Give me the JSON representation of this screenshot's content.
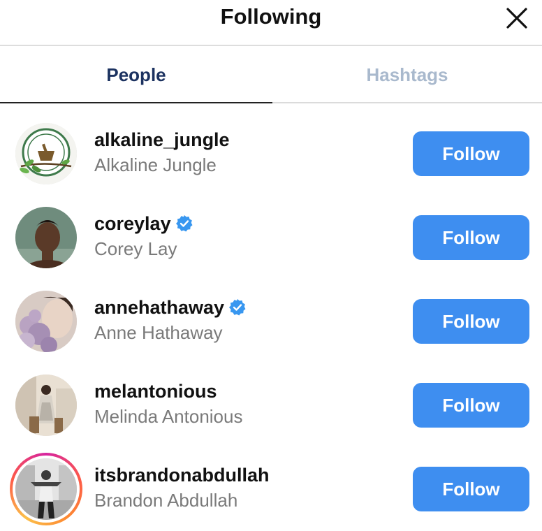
{
  "header": {
    "title": "Following",
    "close_icon": "close-icon"
  },
  "tabs": [
    {
      "label": "People",
      "active": true
    },
    {
      "label": "Hashtags",
      "active": false
    }
  ],
  "colors": {
    "follow_button": "#3e8ef0",
    "active_tab": "#1c3260",
    "inactive_tab": "#a9b9cd",
    "verified_badge": "#3897f0",
    "fullname": "#7a7a7a"
  },
  "users": [
    {
      "username": "alkaline_jungle",
      "full_name": "Alkaline Jungle",
      "verified": false,
      "story_ring": false,
      "button_label": "Follow"
    },
    {
      "username": "coreylay",
      "full_name": "Corey Lay",
      "verified": true,
      "story_ring": false,
      "button_label": "Follow"
    },
    {
      "username": "annehathaway",
      "full_name": "Anne Hathaway",
      "verified": true,
      "story_ring": false,
      "button_label": "Follow"
    },
    {
      "username": "melantonious",
      "full_name": "Melinda Antonious",
      "verified": false,
      "story_ring": false,
      "button_label": "Follow"
    },
    {
      "username": "itsbrandonabdullah",
      "full_name": "Brandon Abdullah",
      "verified": false,
      "story_ring": true,
      "button_label": "Follow"
    }
  ]
}
